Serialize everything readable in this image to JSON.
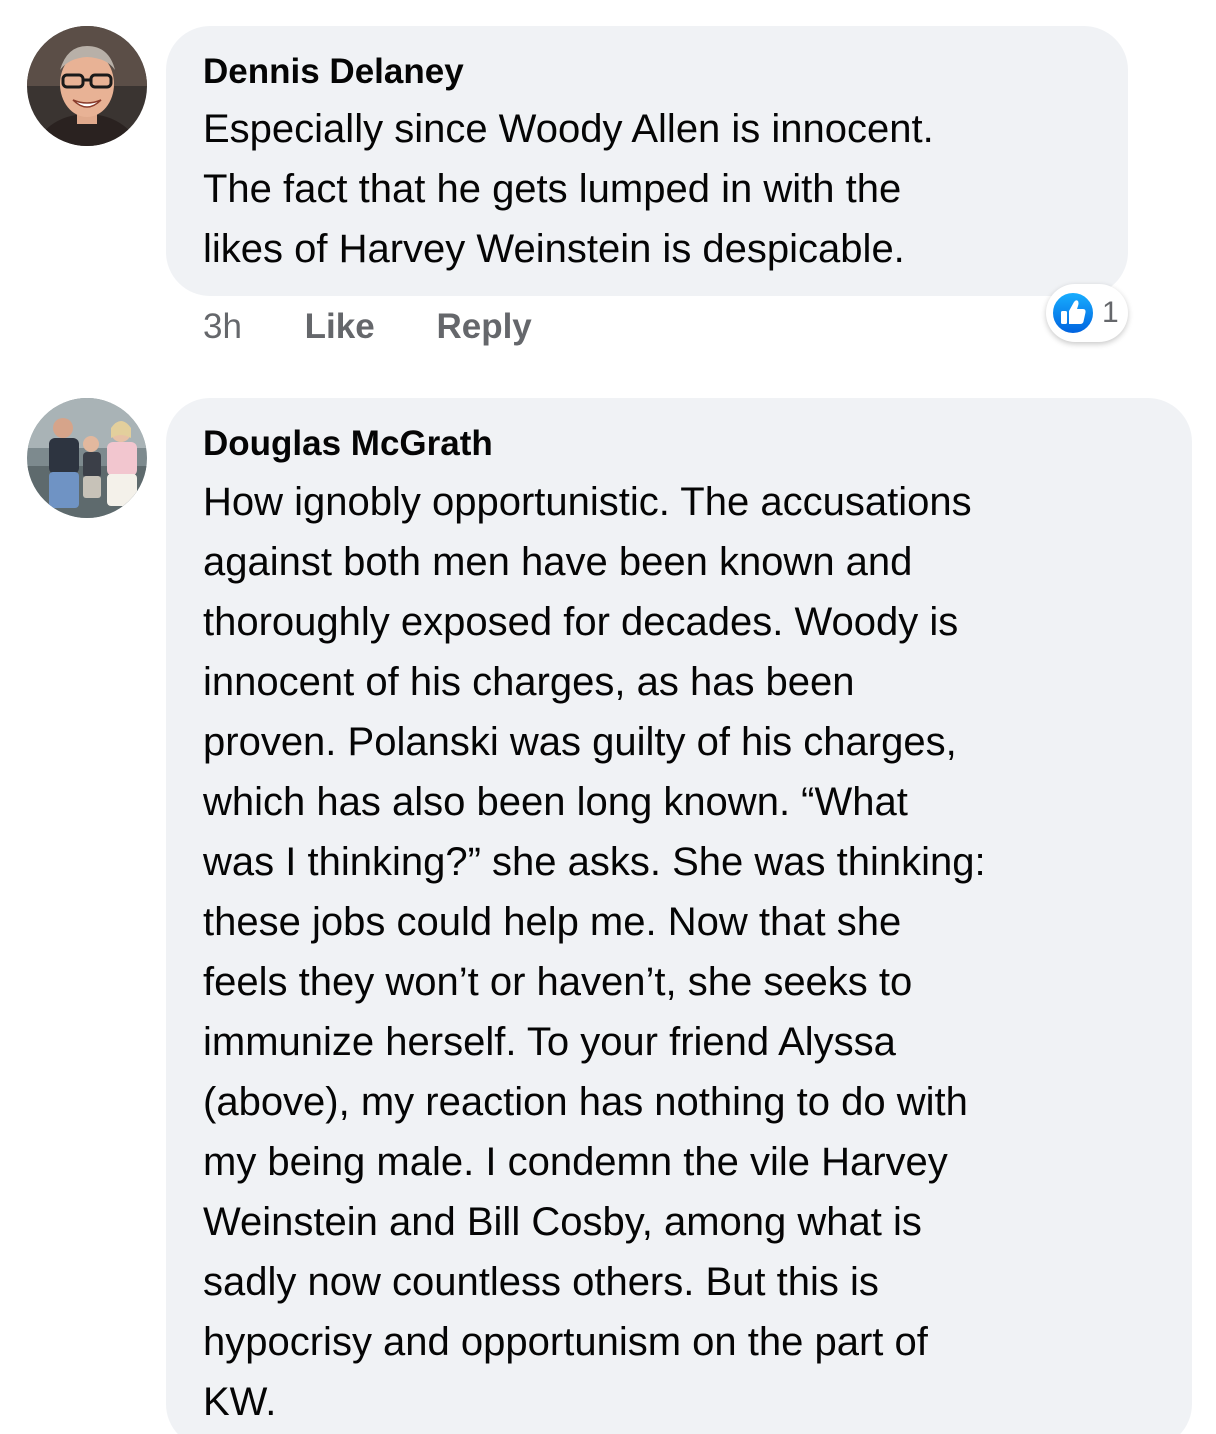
{
  "comments": [
    {
      "author": "Dennis Delaney",
      "lines": [
        "Especially since Woody Allen is innocent.",
        "The fact that he gets lumped in with the",
        "likes of Harvey Weinstein is despicable."
      ],
      "time": "3h",
      "like_label": "Like",
      "reply_label": "Reply",
      "reaction_icon": "thumbs-up-icon",
      "reaction_count": "1"
    },
    {
      "author": "Douglas McGrath",
      "lines": [
        "How ignobly opportunistic. The accusations",
        "against both men have been known and",
        "thoroughly exposed for decades. Woody is",
        "innocent of his charges, as has been",
        "proven. Polanski was guilty of his charges,",
        "which has also been long known. “What",
        "was I thinking?” she asks. She was thinking:",
        "these jobs could help me. Now that she",
        "feels they won’t or haven’t, she seeks to",
        "immunize herself. To your friend Alyssa",
        "(above), my reaction has nothing to do with",
        "my being male. I condemn the vile Harvey",
        "Weinstein and Bill Cosby, among what is",
        "sadly now countless others. But this is",
        "hypocrisy and opportunism on the part of",
        "KW."
      ]
    }
  ],
  "colors": {
    "bubble_background": "#f0f2f5",
    "text_primary": "#050505",
    "text_secondary": "#65676b",
    "like_blue": "#1877f2"
  }
}
